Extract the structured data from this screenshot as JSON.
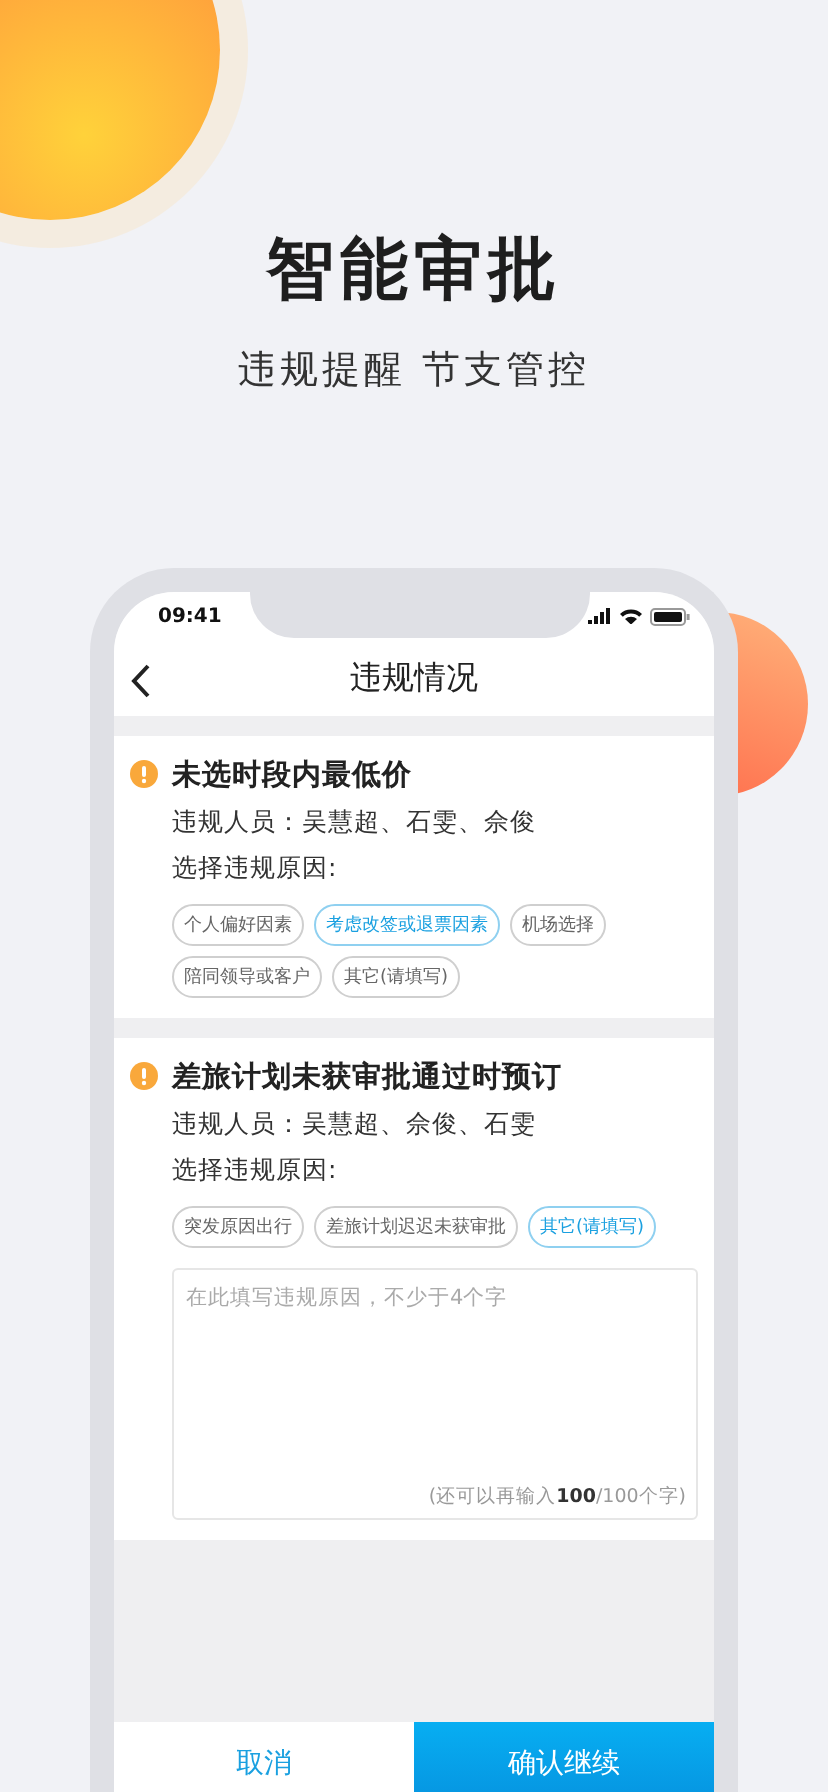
{
  "header": {
    "title": "智能审批",
    "subtitle": "违规提醒 节支管控"
  },
  "status_bar": {
    "time": "09:41"
  },
  "nav": {
    "title": "违规情况"
  },
  "violations": [
    {
      "title": "未选时段内最低价",
      "people": "违规人员：吴慧超、石雯、佘俊",
      "reason_label": "选择违规原因:",
      "reasons": [
        {
          "label": "个人偏好因素",
          "selected": false
        },
        {
          "label": "考虑改签或退票因素",
          "selected": true
        },
        {
          "label": "机场选择",
          "selected": false
        },
        {
          "label": "陪同领导或客户",
          "selected": false
        },
        {
          "label": "其它(请填写)",
          "selected": false
        }
      ]
    },
    {
      "title": "差旅计划未获审批通过时预订",
      "people": "违规人员：吴慧超、佘俊、石雯",
      "reason_label": "选择违规原因:",
      "reasons": [
        {
          "label": "突发原因出行",
          "selected": false
        },
        {
          "label": "差旅计划迟迟未获审批",
          "selected": false
        },
        {
          "label": "其它(请填写)",
          "selected": true
        }
      ],
      "note": {
        "placeholder": "在此填写违规原因，不少于4个字",
        "counter": "(还可以再输入**100**/100个字)"
      }
    }
  ],
  "buttons": [
    {
      "label": "取消",
      "kind": "secondary"
    },
    {
      "label": "确认继续",
      "kind": "primary"
    }
  ]
}
